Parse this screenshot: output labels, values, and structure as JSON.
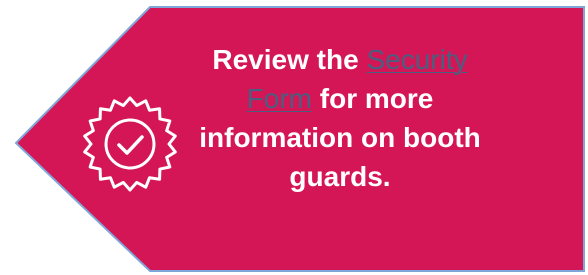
{
  "callout": {
    "background_color": "#d41657",
    "border_color": "#7fa6d8",
    "icon": "verified-badge-check-icon",
    "message": {
      "prefix": "Review the ",
      "link_text": "Security Form",
      "link_color": "#4a5f80",
      "suffix": " for more information on booth guards."
    }
  }
}
